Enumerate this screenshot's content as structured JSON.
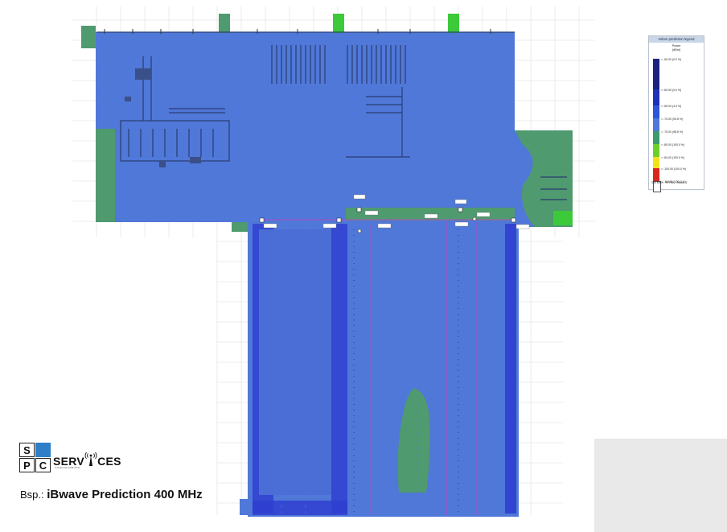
{
  "legend": {
    "title": "Indoor prediction legend",
    "subtitle_line1": "Power",
    "subtitle_line2": "[dBm]",
    "items": [
      {
        "label": "> -50.00 (0.0 %)",
        "color": "#1a237e"
      },
      {
        "label": "> -60.00 (0.0 %)",
        "color": "#1e2fb8"
      },
      {
        "label": "> -65.00 (4.3 %)",
        "color": "#2f56d8"
      },
      {
        "label": "> -70.00 (90.8 %)",
        "color": "#4f78d8"
      },
      {
        "label": "> -75.00 (98.6 %)",
        "color": "#3e9a6b"
      },
      {
        "label": "> -80.00 (100.0 %)",
        "color": "#6ccf2a"
      },
      {
        "label": "> -84.00 (100.0 %)",
        "color": "#f2e21b"
      },
      {
        "label": "> -100.00 (100.0 %)",
        "color": "#d8281e"
      },
      {
        "label": "> -110.00 (100.0 %)",
        "color": "#ffffff"
      }
    ],
    "footer": "380 MHz - TETRA - Sector 1"
  },
  "logo": {
    "letters": [
      "S",
      "",
      "P",
      "C"
    ],
    "word_left": "SERV",
    "word_right": "CES",
    "tagline": "INGENIEURBÜRO",
    "accent": "#2e7fc8"
  },
  "caption": {
    "prefix": "Bsp.: ",
    "main": "iBwave Prediction 400 MHz"
  },
  "colors": {
    "coverage_main": "#4f78d8",
    "coverage_strong": "#2f3fd0",
    "coverage_weak": "#4f9a6e",
    "coverage_green": "#3cc93a",
    "grid": "#dcdcdc"
  }
}
